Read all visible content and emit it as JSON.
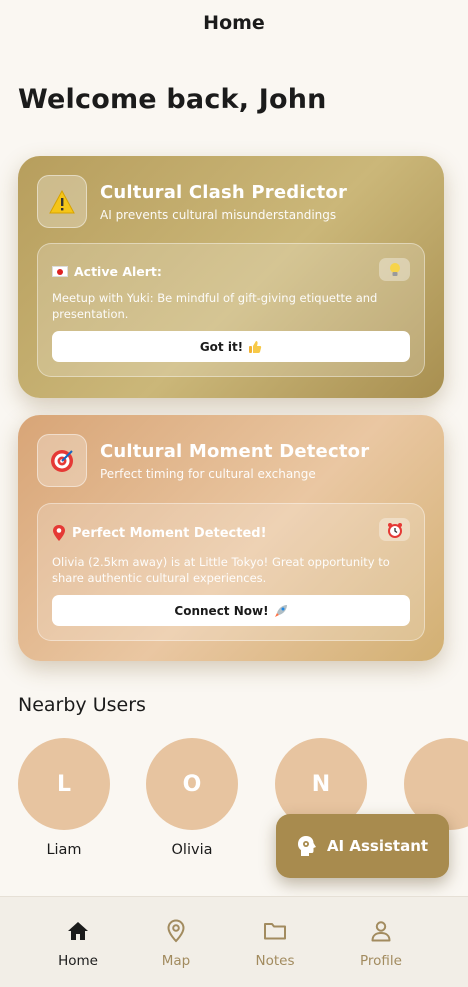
{
  "header": {
    "title": "Home"
  },
  "welcome": "Welcome back, John",
  "clash": {
    "title": "Cultural Clash Predictor",
    "subtitle": "AI prevents cultural misunderstandings",
    "icon": "warning-icon",
    "alert_title": "Active Alert:",
    "alert_flag": "japan-flag-icon",
    "badge_icon": "lightbulb-icon",
    "alert_text": "Meetup with Yuki: Be mindful of gift-giving etiquette and presentation.",
    "button_label": "Got it!",
    "button_icon": "thumbs-up-icon"
  },
  "moment": {
    "title": "Cultural Moment Detector",
    "subtitle": "Perfect timing for cultural exchange",
    "icon": "target-icon",
    "alert_title": "Perfect Moment Detected!",
    "alert_icon": "pin-icon",
    "badge_icon": "alarm-clock-icon",
    "alert_text": "Olivia (2.5km away) is at Little Tokyo! Great opportunity to share authentic cultural experiences.",
    "button_label": "Connect Now!",
    "button_icon": "rocket-icon"
  },
  "nearby": {
    "title": "Nearby Users",
    "users": [
      {
        "initial": "L",
        "name": "Liam"
      },
      {
        "initial": "O",
        "name": "Olivia"
      },
      {
        "initial": "N",
        "name": ""
      },
      {
        "initial": "",
        "name": ""
      }
    ]
  },
  "ai_assistant": {
    "label": "AI Assistant",
    "icon": "brain-head-icon"
  },
  "nav": {
    "items": [
      {
        "label": "Home",
        "icon": "home-icon",
        "active": true
      },
      {
        "label": "Map",
        "icon": "map-pin-icon",
        "active": false
      },
      {
        "label": "Notes",
        "icon": "folder-icon",
        "active": false
      },
      {
        "label": "Profile",
        "icon": "person-icon",
        "active": false
      }
    ]
  },
  "colors": {
    "background": "#faf7f2",
    "accent": "#a88b4e",
    "avatar": "#e7c4a0",
    "nav_inactive": "#a28b5f"
  }
}
